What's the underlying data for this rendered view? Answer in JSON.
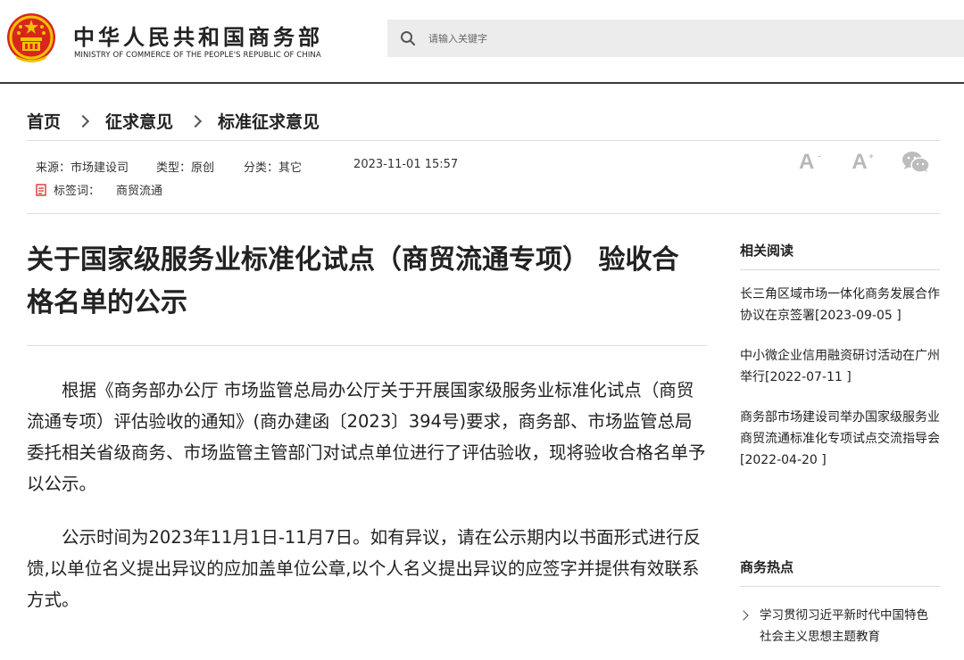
{
  "header": {
    "site_name_cn": "中华人民共和国商务部",
    "site_name_en": "MINISTRY OF COMMERCE OF THE PEOPLE'S REPUBLIC OF CHINA",
    "search_placeholder": "请输入关键字"
  },
  "breadcrumb": {
    "items": [
      "首页",
      "征求意见",
      "标准征求意见"
    ]
  },
  "meta": {
    "source": "来源：市场建设司",
    "type": "类型：原创",
    "category": "分类：其它",
    "datetime": "2023-11-01 15:57",
    "tags_label": "标签词：",
    "tags_value": "商贸流通"
  },
  "tools": {
    "font_smaller": "A",
    "font_smaller_mark": "-",
    "font_larger": "A",
    "font_larger_mark": "+"
  },
  "article": {
    "title": "关于国家级服务业标准化试点（商贸流通专项） 验收合格名单的公示",
    "paragraphs": [
      "根据《商务部办公厅 市场监管总局办公厅关于开展国家级服务业标准化试点（商贸流通专项）评估验收的通知》(商办建函〔2023〕394号)要求，商务部、市场监管总局委托相关省级商务、市场监管主管部门对试点单位进行了评估验收，现将验收合格名单予以公示。",
      "公示时间为2023年11月1日-11月7日。如有异议，请在公示期内以书面形式进行反馈,以单位名义提出异议的应加盖单位公章,以个人名义提出异议的应签字并提供有效联系方式。"
    ]
  },
  "sidebar": {
    "related_heading": "相关阅读",
    "related": [
      "长三角区域市场一体化商务发展合作协议在京签署[2023-09-05 ]",
      "中小微企业信用融资研讨活动在广州举行[2022-07-11 ]",
      "商务部市场建设司举办国家级服务业商贸流通标准化专项试点交流指导会[2022-04-20 ]"
    ],
    "hot_heading": "商务热点",
    "hot": [
      "学习贯彻习近平新时代中国特色社会主义思想主题教育"
    ]
  },
  "colors": {
    "emblem_red": "#d7261e",
    "emblem_gold": "#f2c200",
    "divider": "#dcdcdc"
  }
}
